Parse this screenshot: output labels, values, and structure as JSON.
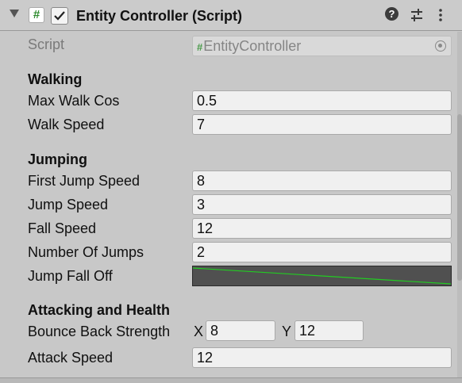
{
  "header": {
    "title": "Entity Controller (Script)",
    "enabled": true,
    "icons": [
      "foldout-arrow-icon",
      "script-hash-icon",
      "help-icon",
      "presets-icon",
      "context-menu-icon"
    ]
  },
  "script_field": {
    "label": "Script",
    "hash": "#",
    "value": "EntityController"
  },
  "sections": {
    "walking": "Walking",
    "jumping": "Jumping",
    "attacking": "Attacking and Health"
  },
  "fields": {
    "max_walk_cos": {
      "label": "Max Walk Cos",
      "value": "0.5"
    },
    "walk_speed": {
      "label": "Walk Speed",
      "value": "7"
    },
    "first_jump_speed": {
      "label": "First Jump Speed",
      "value": "8"
    },
    "jump_speed": {
      "label": "Jump Speed",
      "value": "3"
    },
    "fall_speed": {
      "label": "Fall Speed",
      "value": "12"
    },
    "number_of_jumps": {
      "label": "Number Of Jumps",
      "value": "2"
    },
    "jump_fall_off": {
      "label": "Jump Fall Off",
      "curve_color": "#22cc22"
    },
    "bounce_back_strength": {
      "label": "Bounce Back Strength",
      "x_label": "X",
      "x_value": "8",
      "y_label": "Y",
      "y_value": "12"
    },
    "attack_speed": {
      "label": "Attack Speed",
      "value": "12"
    }
  },
  "colors": {
    "panel_bg": "#c8c8c8",
    "field_bg": "#f0f0f0",
    "curve_bg": "#505050",
    "script_hash": "#2e8b2e"
  }
}
